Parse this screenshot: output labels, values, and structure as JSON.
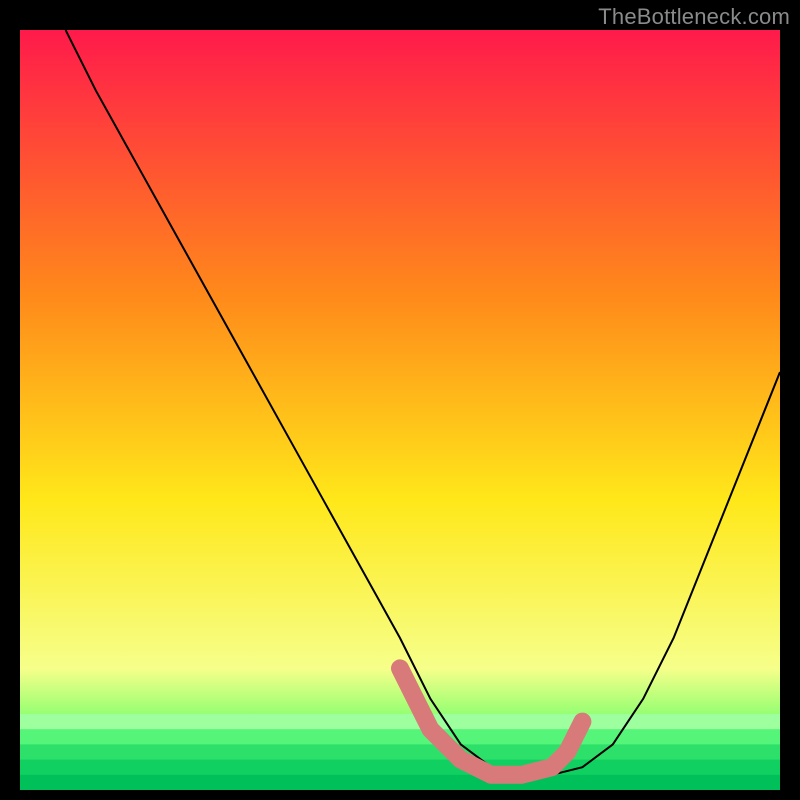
{
  "watermark": "TheBottleneck.com",
  "colors": {
    "gradient_top": "#ff1a4b",
    "gradient_mid1": "#ff8a1a",
    "gradient_mid2": "#ffe81a",
    "gradient_low": "#f6ff8a",
    "gradient_green1": "#66ff66",
    "gradient_green2": "#00e05a",
    "curve": "#000000",
    "marker": "#d87a7a",
    "frame": "#000000"
  },
  "chart_data": {
    "type": "line",
    "title": "",
    "xlabel": "",
    "ylabel": "",
    "xlim": [
      0,
      100
    ],
    "ylim": [
      0,
      100
    ],
    "series": [
      {
        "name": "bottleneck-curve",
        "x": [
          6,
          10,
          15,
          20,
          25,
          30,
          35,
          40,
          45,
          50,
          54,
          58,
          62,
          66,
          70,
          74,
          78,
          82,
          86,
          90,
          94,
          100
        ],
        "values": [
          100,
          92,
          83,
          74,
          65,
          56,
          47,
          38,
          29,
          20,
          12,
          6,
          3,
          2,
          2,
          3,
          6,
          12,
          20,
          30,
          40,
          55
        ]
      }
    ],
    "markers": {
      "name": "highlight-band",
      "x": [
        50,
        54,
        58,
        62,
        66,
        70,
        72,
        74
      ],
      "values": [
        16,
        8,
        4,
        2,
        2,
        3,
        5,
        9
      ]
    }
  }
}
